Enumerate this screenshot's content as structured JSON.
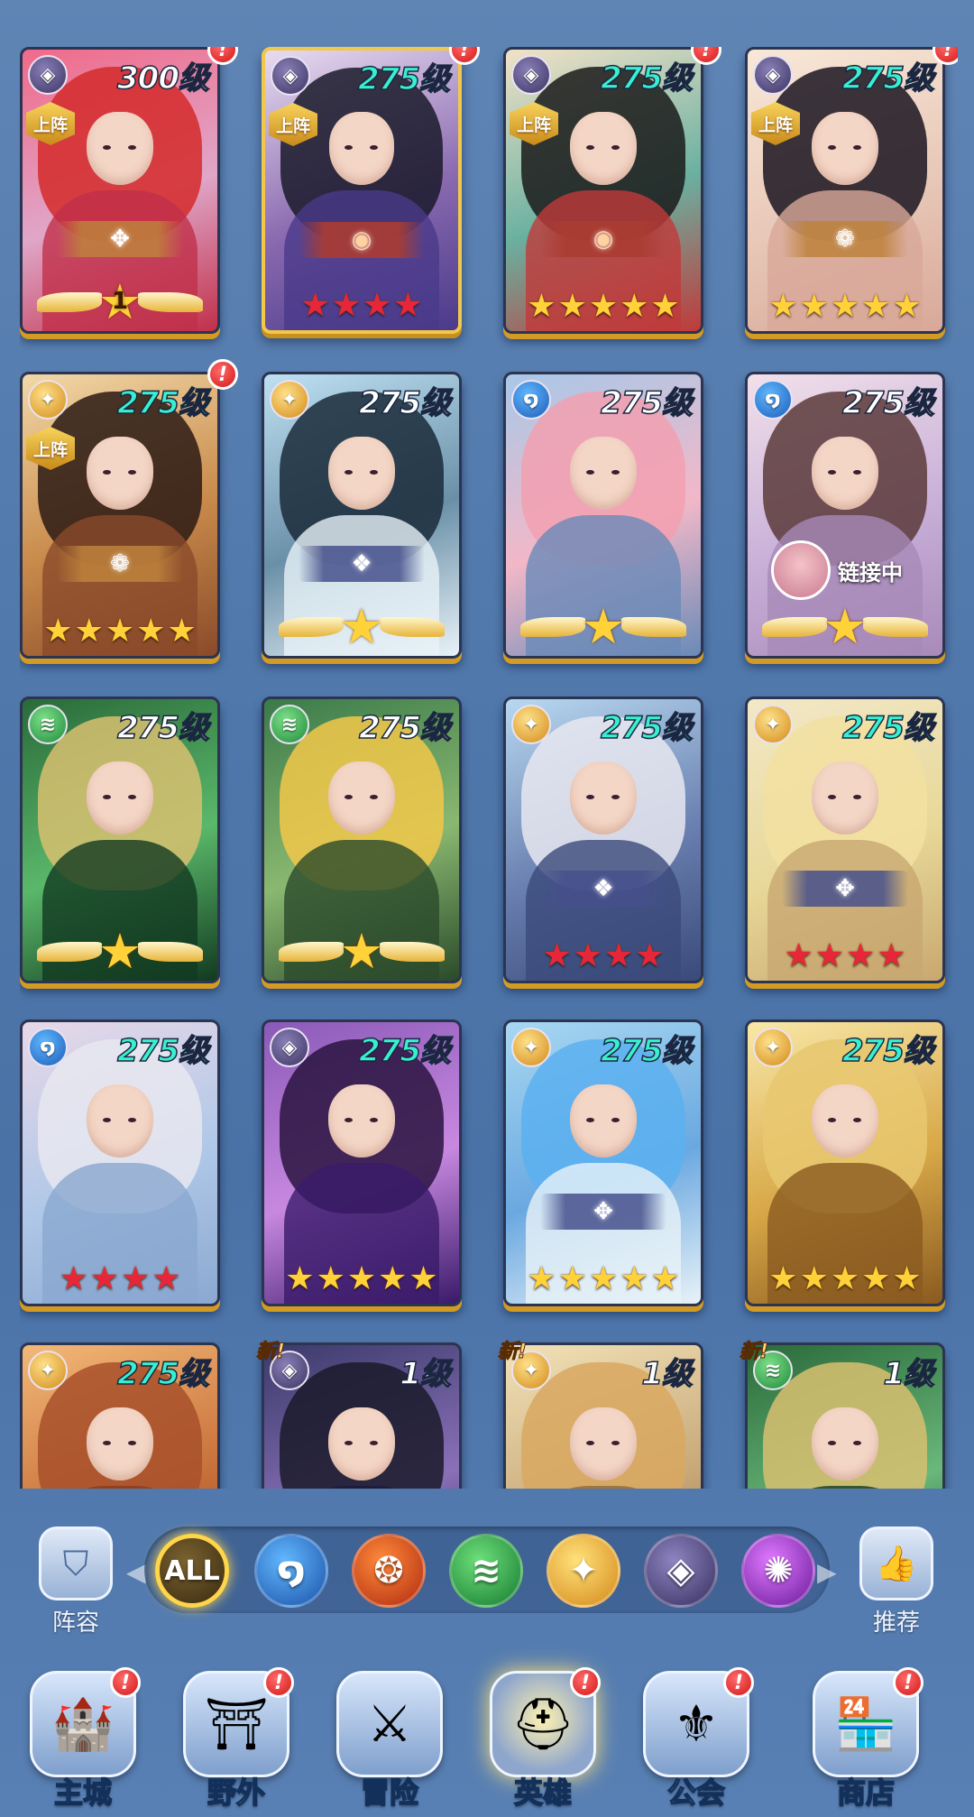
{
  "heroes": [
    {
      "level": "300级",
      "level_color": "white",
      "element": "dark",
      "element_glyph": "◈",
      "deploy": "上阵",
      "alert": true,
      "stars": "wing",
      "wing_number": "1",
      "emblem": "gold",
      "emblem_glyph": "✥",
      "bg": [
        "#f06a8a",
        "#e0a6c8",
        "#c0304a"
      ],
      "hair": "#d42a2a",
      "gold_border": false
    },
    {
      "level": "275级",
      "level_color": "teal",
      "element": "dark",
      "element_glyph": "◈",
      "deploy": "上阵",
      "alert": true,
      "stars": "red",
      "star_count": 4,
      "emblem": "red",
      "emblem_glyph": "◉",
      "bg": [
        "#e8dcf0",
        "#8a6ab0",
        "#4a3a8a"
      ],
      "hair": "#1a1a2a",
      "gold_border": true
    },
    {
      "level": "275级",
      "level_color": "teal",
      "element": "dark",
      "element_glyph": "◈",
      "deploy": "上阵",
      "alert": true,
      "stars": "gold",
      "star_count": 5,
      "emblem": "red",
      "emblem_glyph": "◉",
      "bg": [
        "#f2e2c8",
        "#6ab0a0",
        "#c03a3a"
      ],
      "hair": "#1a1a1a",
      "gold_border": false
    },
    {
      "level": "275级",
      "level_color": "teal",
      "element": "dark",
      "element_glyph": "◈",
      "deploy": "上阵",
      "alert": true,
      "stars": "gold",
      "star_count": 5,
      "emblem": "gold",
      "emblem_glyph": "❁",
      "bg": [
        "#f8e8d8",
        "#e8c8b8",
        "#d8a898"
      ],
      "hair": "#1a1420",
      "gold_border": false
    },
    {
      "level": "275级",
      "level_color": "teal",
      "element": "light",
      "element_glyph": "✦",
      "deploy": "上阵",
      "alert": true,
      "stars": "gold",
      "star_count": 5,
      "emblem": "gold",
      "emblem_glyph": "❁",
      "bg": [
        "#f2d8a8",
        "#c88a4a",
        "#8a4a2a"
      ],
      "hair": "#2a1a14",
      "gold_border": false
    },
    {
      "level": "275级",
      "level_color": "white",
      "element": "light",
      "element_glyph": "✦",
      "deploy": "",
      "alert": false,
      "stars": "wing",
      "wing_number": "",
      "emblem": "blue",
      "emblem_glyph": "❖",
      "bg": [
        "#bfe0f2",
        "#6a90a8",
        "#e8f2f8"
      ],
      "hair": "#1a2a3a",
      "gold_border": false
    },
    {
      "level": "275级",
      "level_color": "white",
      "element": "water",
      "element_glyph": "໑",
      "deploy": "",
      "alert": false,
      "stars": "wing",
      "wing_number": "",
      "emblem": "",
      "emblem_glyph": "",
      "bg": [
        "#a8c8e8",
        "#f2b8c8",
        "#6a8ab8"
      ],
      "hair": "#f2a0b0",
      "gold_border": false
    },
    {
      "level": "275级",
      "level_color": "white",
      "element": "water",
      "element_glyph": "໑",
      "deploy": "",
      "alert": false,
      "stars": "wing",
      "wing_number": "",
      "emblem": "",
      "emblem_glyph": "",
      "bg": [
        "#f2e0ea",
        "#c8b0d8",
        "#a88ab8"
      ],
      "hair": "#5a3a3a",
      "gold_border": false,
      "link": "链接中"
    },
    {
      "level": "275级",
      "level_color": "white",
      "element": "wind",
      "element_glyph": "≋",
      "deploy": "",
      "alert": false,
      "stars": "wing",
      "wing_number": "",
      "emblem": "",
      "emblem_glyph": "",
      "bg": [
        "#2a6a3a",
        "#5ab86a",
        "#123a20"
      ],
      "hair": "#d8c070",
      "gold_border": false
    },
    {
      "level": "275级",
      "level_color": "white",
      "element": "wind",
      "element_glyph": "≋",
      "deploy": "",
      "alert": false,
      "stars": "wing",
      "wing_number": "",
      "emblem": "",
      "emblem_glyph": "",
      "bg": [
        "#3a7a4a",
        "#8ab870",
        "#2a4a2a"
      ],
      "hair": "#f2c84a",
      "gold_border": false
    },
    {
      "level": "275级",
      "level_color": "teal",
      "element": "light",
      "element_glyph": "✦",
      "deploy": "",
      "alert": false,
      "stars": "red",
      "star_count": 4,
      "emblem": "blue",
      "emblem_glyph": "❖",
      "bg": [
        "#b8d8f0",
        "#6a80b0",
        "#3a4a7a"
      ],
      "hair": "#e8e8f0",
      "gold_border": false
    },
    {
      "level": "275级",
      "level_color": "teal",
      "element": "light",
      "element_glyph": "✦",
      "deploy": "",
      "alert": false,
      "stars": "red",
      "star_count": 4,
      "emblem": "blue",
      "emblem_glyph": "✥",
      "bg": [
        "#f2e8c8",
        "#e8d898",
        "#c8a870"
      ],
      "hair": "#f2e0a0",
      "gold_border": false
    },
    {
      "level": "275级",
      "level_color": "teal",
      "element": "water",
      "element_glyph": "໑",
      "deploy": "",
      "alert": false,
      "stars": "red",
      "star_count": 4,
      "emblem": "",
      "emblem_glyph": "",
      "bg": [
        "#e8d8e8",
        "#b0c8e8",
        "#8aa8d0"
      ],
      "hair": "#e8e8f0",
      "gold_border": false
    },
    {
      "level": "275级",
      "level_color": "teal",
      "element": "dark",
      "element_glyph": "◈",
      "deploy": "",
      "alert": false,
      "stars": "gold",
      "star_count": 5,
      "emblem": "",
      "emblem_glyph": "",
      "bg": [
        "#8a5ab8",
        "#c888e0",
        "#3a1a6a"
      ],
      "hair": "#2a1440",
      "gold_border": false
    },
    {
      "level": "275级",
      "level_color": "teal",
      "element": "light",
      "element_glyph": "✦",
      "deploy": "",
      "alert": false,
      "stars": "gold",
      "star_count": 5,
      "emblem": "blue",
      "emblem_glyph": "✥",
      "bg": [
        "#a8d8f2",
        "#6aa8e0",
        "#e8f2f8"
      ],
      "hair": "#5ab0f0",
      "gold_border": false
    },
    {
      "level": "275级",
      "level_color": "teal",
      "element": "light",
      "element_glyph": "✦",
      "deploy": "",
      "alert": false,
      "stars": "gold",
      "star_count": 5,
      "emblem": "",
      "emblem_glyph": "",
      "bg": [
        "#f8e8a8",
        "#d8a848",
        "#8a5a20"
      ],
      "hair": "#e8c870",
      "gold_border": false
    },
    {
      "level": "275级",
      "level_color": "teal",
      "element": "light",
      "element_glyph": "✦",
      "deploy": "",
      "alert": false,
      "stars": "none",
      "emblem": "",
      "emblem_glyph": "",
      "bg": [
        "#f2b878",
        "#c8703a",
        "#8a3a1a"
      ],
      "hair": "#a8502a",
      "gold_border": false
    },
    {
      "level": "1级",
      "level_color": "white",
      "element": "dark",
      "element_glyph": "◈",
      "deploy": "",
      "alert": false,
      "stars": "none",
      "new": "新!",
      "emblem": "",
      "emblem_glyph": "",
      "bg": [
        "#3a3a6a",
        "#8a70b8",
        "#1a1a3a"
      ],
      "hair": "#1a1a2a",
      "gold_border": false
    },
    {
      "level": "1级",
      "level_color": "white",
      "element": "light",
      "element_glyph": "✦",
      "deploy": "",
      "alert": false,
      "stars": "none",
      "new": "新!",
      "emblem": "",
      "emblem_glyph": "",
      "bg": [
        "#f2e2b8",
        "#c8a878",
        "#8a6a3a"
      ],
      "hair": "#d8a860",
      "gold_border": false
    },
    {
      "level": "1级",
      "level_color": "white",
      "element": "wind",
      "element_glyph": "≋",
      "deploy": "",
      "alert": false,
      "stars": "none",
      "new": "新!",
      "emblem": "",
      "emblem_glyph": "",
      "bg": [
        "#2a6a3a",
        "#6ab87a",
        "#123a20"
      ],
      "hair": "#d8c070",
      "gold_border": false
    }
  ],
  "filters": {
    "left_button": {
      "label": "阵容",
      "icon": "shield-icon"
    },
    "right_button": {
      "label": "推荐",
      "icon": "thumbs-up-icon"
    },
    "chips": [
      {
        "key": "all",
        "label": "ALL"
      },
      {
        "key": "water",
        "label": "໑"
      },
      {
        "key": "fire",
        "label": "❂"
      },
      {
        "key": "wind",
        "label": "≋"
      },
      {
        "key": "light",
        "label": "✦"
      },
      {
        "key": "dark",
        "label": "◈"
      },
      {
        "key": "arcane",
        "label": "✺"
      }
    ]
  },
  "nav": [
    {
      "label": "主城",
      "icon": "castle-icon",
      "glyph": "🏰",
      "alert": true,
      "active": false
    },
    {
      "label": "野外",
      "icon": "wild-gate-icon",
      "glyph": "⛩",
      "alert": true,
      "active": false
    },
    {
      "label": "冒险",
      "icon": "adventure-gate-icon",
      "glyph": "⚔",
      "alert": false,
      "active": false
    },
    {
      "label": "英雄",
      "icon": "knight-helmet-icon",
      "glyph": "⛑",
      "alert": true,
      "active": true
    },
    {
      "label": "公会",
      "icon": "guild-banner-icon",
      "glyph": "⚜",
      "alert": true,
      "active": false
    },
    {
      "label": "商店",
      "icon": "shop-icon",
      "glyph": "🏪",
      "alert": true,
      "active": false
    }
  ],
  "alert_mark": "!"
}
